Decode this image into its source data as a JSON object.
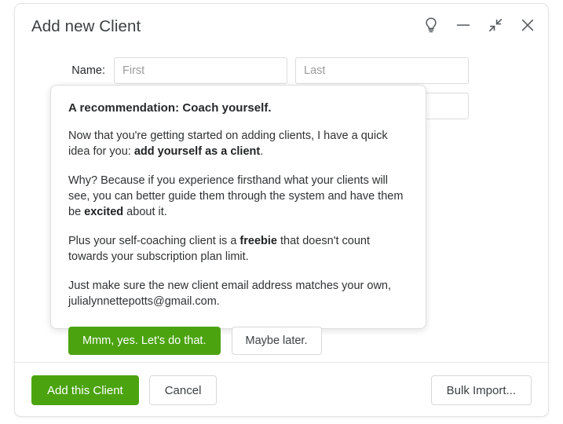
{
  "window": {
    "title": "Add new Client",
    "controls": [
      {
        "name": "tips-lightbulb-button",
        "icon": "lightbulb-icon",
        "label": "Tips"
      },
      {
        "name": "minimize-button",
        "icon": "minimize-icon",
        "label": "Minimize"
      },
      {
        "name": "collapse-button",
        "icon": "collapse-arrows-icon",
        "label": "Collapse"
      },
      {
        "name": "close-button",
        "icon": "close-icon",
        "label": "Close"
      }
    ]
  },
  "form": {
    "name_label": "Name:",
    "first_placeholder": "First",
    "first_value": "",
    "last_placeholder": "Last",
    "last_value": "",
    "second_placeholder": "",
    "second_value": ""
  },
  "popover": {
    "title": "A recommendation: Coach yourself.",
    "paragraph1_a": "Now that you're getting started on adding clients, I have a quick idea for you: ",
    "paragraph1_bold": "add yourself as a client",
    "paragraph1_b": ".",
    "paragraph2_a": "Why? Because if you experience firsthand what your clients will see, you can better guide them through the system and have them be ",
    "paragraph2_bold": "excited",
    "paragraph2_b": " about it.",
    "paragraph3_a": "Plus your self-coaching client is a ",
    "paragraph3_bold": "freebie",
    "paragraph3_b": " that doesn't count towards your subscription plan limit.",
    "paragraph4": "Just make sure the new client email address matches your own, julialynnettepotts@gmail.com.",
    "accept_label": "Mmm, yes. Let's do that.",
    "dismiss_label": "Maybe later."
  },
  "footer": {
    "submit_label": "Add this Client",
    "cancel_label": "Cancel",
    "bulk_import_label": "Bulk Import..."
  },
  "colors": {
    "accent_green": "#4ba310",
    "title_text": "#3c4043",
    "body_text": "#2f3133",
    "placeholder": "#9b9b9b",
    "border": "#dcdcdc"
  }
}
